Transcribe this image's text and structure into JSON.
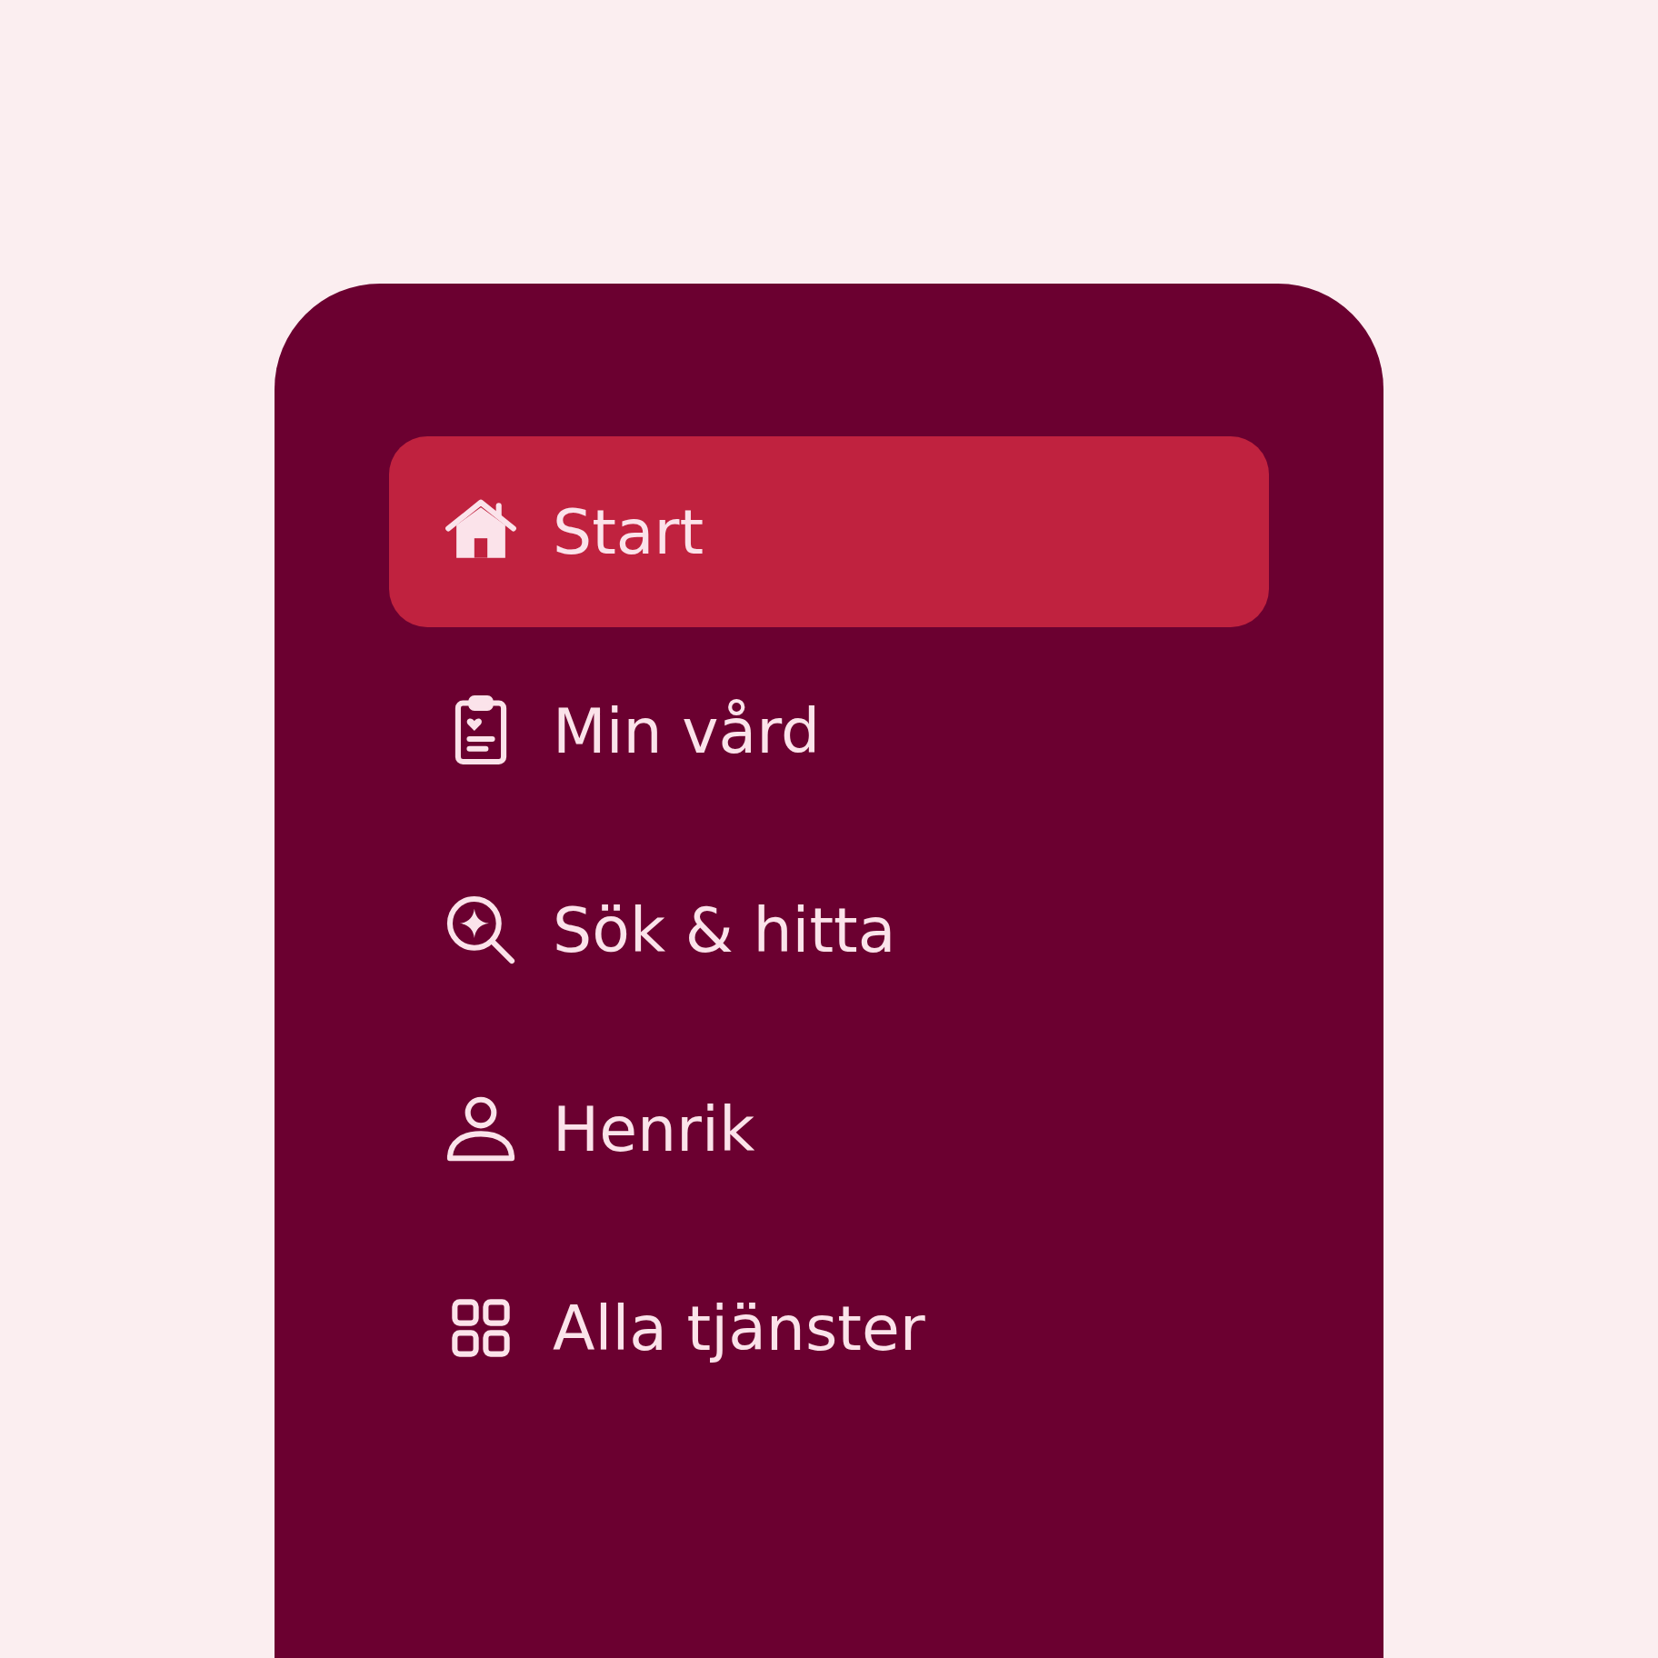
{
  "nav": {
    "items": [
      {
        "label": "Start",
        "selected": true
      },
      {
        "label": "Min vård",
        "selected": false
      },
      {
        "label": "Sök & hitta",
        "selected": false
      },
      {
        "label": "Henrik",
        "selected": false
      },
      {
        "label": "Alla tjänster",
        "selected": false
      }
    ]
  }
}
